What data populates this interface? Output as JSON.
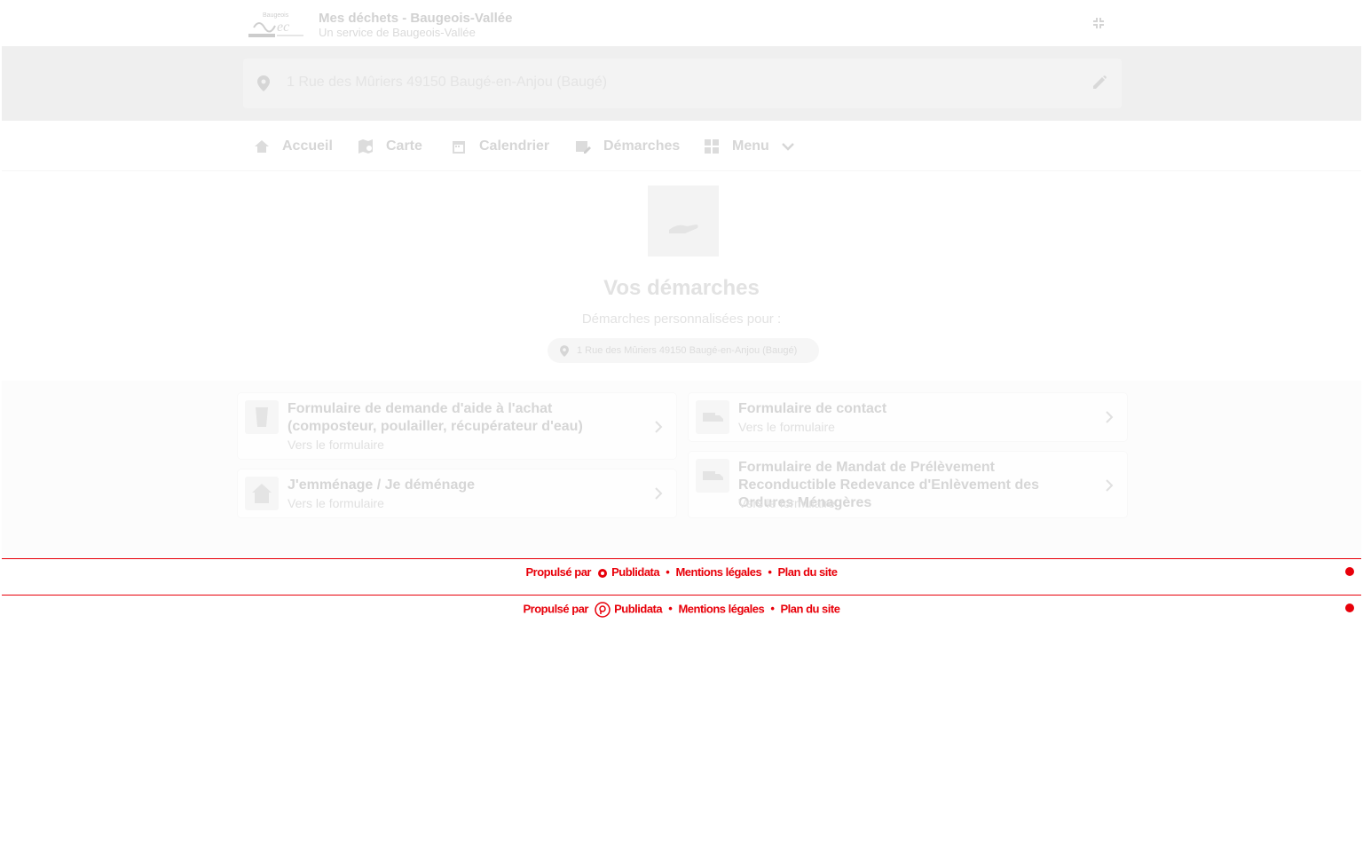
{
  "header": {
    "title": "Mes déchets - Baugeois-Vallée",
    "subtitle": "Un service de Baugeois-Vallée",
    "logo_icon": "baugeois-vallee-logo",
    "collapse_icon": "collapse-icon"
  },
  "address_bar": {
    "address": "1 Rue des Mûriers 49150 Baugé-en-Anjou (Baugé)"
  },
  "nav": {
    "items": [
      {
        "label": "Accueil",
        "icon": "home-icon"
      },
      {
        "label": "Carte",
        "icon": "map-icon"
      },
      {
        "label": "Calendrier",
        "icon": "calendar-icon"
      },
      {
        "label": "Démarches",
        "icon": "form-icon"
      },
      {
        "label": "Menu",
        "icon": "grid-icon"
      }
    ]
  },
  "hero": {
    "title": "Vos démarches",
    "subtitle": "Démarches personnalisées pour :",
    "address_chip": "1 Rue des Mûriers 49150 Baugé-en-Anjou (Baugé)"
  },
  "cards": [
    {
      "title": "Formulaire de demande d'aide à l'achat (composteur, poulailler, récupérateur d'eau)",
      "link": "Vers le formulaire"
    },
    {
      "title": "Formulaire de contact",
      "link": "Vers le formulaire"
    },
    {
      "title": "J'emménage / Je déménage",
      "link": "Vers le formulaire"
    },
    {
      "title": "Formulaire de Mandat de Prélèvement Reconductible Redevance d'Enlèvement des Ordures Ménagères",
      "link": "Vers le formulaire"
    }
  ],
  "footer": {
    "powered_by": "Propulsé par",
    "brand": "Publidata",
    "legal": "Mentions légales",
    "sitemap": "Plan du site",
    "separator": "•",
    "color": "#e8000a"
  }
}
